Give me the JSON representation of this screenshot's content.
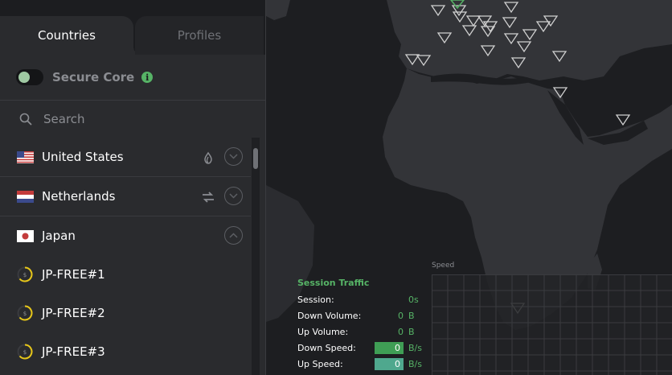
{
  "tabs": [
    {
      "label": "Countries",
      "active": true
    },
    {
      "label": "Profiles",
      "active": false
    }
  ],
  "secure_core": {
    "label": "Secure Core",
    "enabled": false,
    "info_icon": "info-icon"
  },
  "search": {
    "placeholder": "Search",
    "value": ""
  },
  "countries": [
    {
      "name": "United States",
      "flag": "us-flag",
      "feature_icon": "tor-onion-icon",
      "expanded": false
    },
    {
      "name": "Netherlands",
      "flag": "nl-flag",
      "feature_icon": "p2p-arrows-icon",
      "expanded": false
    },
    {
      "name": "Japan",
      "flag": "jp-flag",
      "feature_icon": "",
      "expanded": true
    }
  ],
  "servers": [
    {
      "name": "JP-FREE#1",
      "icon": "server-load-icon"
    },
    {
      "name": "JP-FREE#2",
      "icon": "server-load-icon"
    },
    {
      "name": "JP-FREE#3",
      "icon": "server-load-icon"
    }
  ],
  "session_traffic": {
    "title": "Session Traffic",
    "session": {
      "label": "Session:",
      "value": "0s"
    },
    "down_volume": {
      "label": "Down Volume:",
      "value": "0",
      "unit": "B"
    },
    "up_volume": {
      "label": "Up Volume:",
      "value": "0",
      "unit": "B"
    },
    "down_speed": {
      "label": "Down Speed:",
      "value": "0",
      "unit": "B/s"
    },
    "up_speed": {
      "label": "Up Speed:",
      "value": "0",
      "unit": "B/s"
    }
  },
  "speed_graph": {
    "label": "Speed"
  },
  "colors": {
    "accent_green": "#56b366",
    "down_speed_box": "#3f9e55",
    "up_speed_box": "#4fa88e",
    "panel_bg": "#2a2b2e",
    "map_bg": "#1d1e21",
    "load_ring": "#e6c619"
  }
}
